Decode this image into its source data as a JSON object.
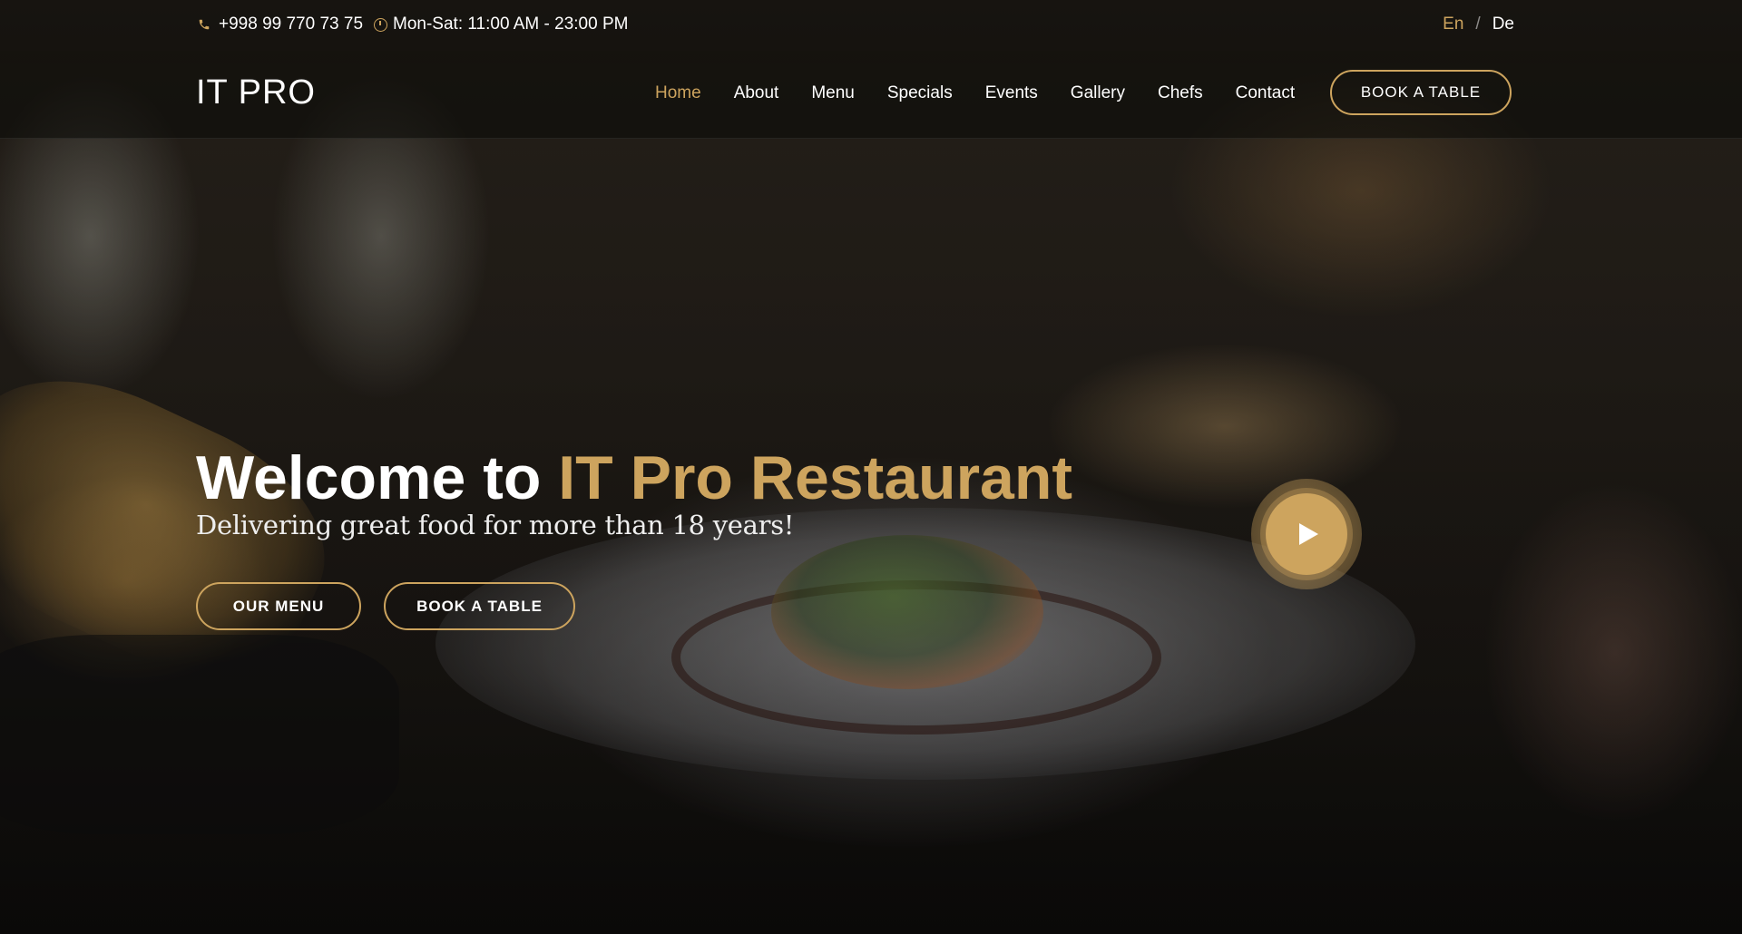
{
  "topbar": {
    "phone": "+998 99 770 73 75",
    "hours": "Mon-Sat: 11:00 AM - 23:00 PM",
    "phone_icon": "phone-icon",
    "hours_icon": "clock-icon",
    "lang_en": "En",
    "lang_separator": "/",
    "lang_de": "De"
  },
  "header": {
    "logo": "IT PRO",
    "nav": [
      "Home",
      "About",
      "Menu",
      "Specials",
      "Events",
      "Gallery",
      "Chefs",
      "Contact"
    ],
    "active_nav": "Home",
    "book_button": "BOOK A TABLE"
  },
  "hero": {
    "title_prefix": "Welcome to ",
    "title_accent": "IT Pro Restaurant",
    "subtitle": "Delivering great food for more than 18 years!",
    "btn_menu": "OUR MENU",
    "btn_book": "BOOK A TABLE",
    "play_icon": "play-icon"
  },
  "colors": {
    "accent": "#cda45e",
    "text": "#ffffff"
  }
}
